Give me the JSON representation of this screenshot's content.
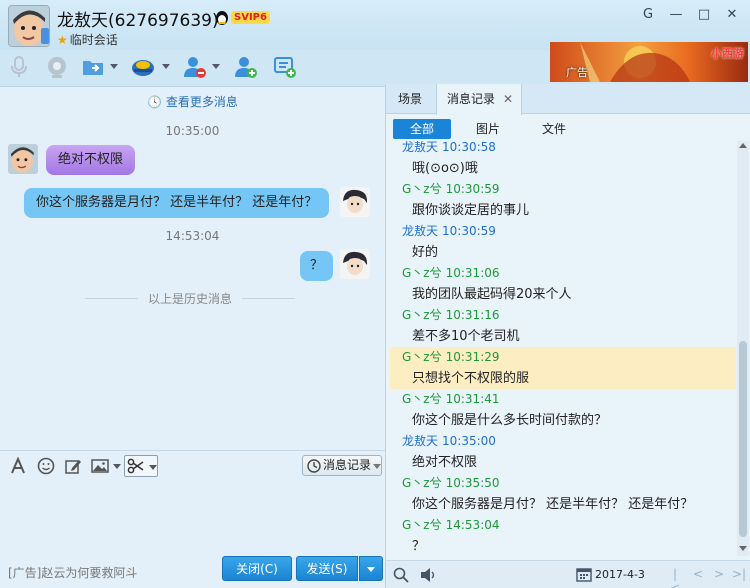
{
  "header": {
    "contact_name": "龙敖天(627697639)",
    "vip_badge": "SVIP6",
    "session_type": "临时会话",
    "window_controls": [
      "G",
      "—",
      "□",
      "✕"
    ]
  },
  "ad_banner": {
    "label": "广告",
    "game_name": "小西游"
  },
  "chat": {
    "more_messages": "查看更多消息",
    "timestamps": [
      "10:35:00",
      "14:53:04"
    ],
    "messages": [
      {
        "side": "in",
        "text": "绝对不权限"
      },
      {
        "side": "out",
        "text": "你这个服务器是月付？  还是半年付？  还是年付？"
      },
      {
        "side": "out",
        "text": "？"
      }
    ],
    "history_divider": "以上是历史消息"
  },
  "input_toolbar": {
    "message_record_button": "消息记录"
  },
  "bottom_bar": {
    "ad_text": "[广告]赵云为何要救阿斗",
    "close_button": "关闭(C)",
    "send_button": "发送(S)"
  },
  "history_panel": {
    "tabs": [
      "场景",
      "消息记录"
    ],
    "subtabs": [
      "全部",
      "图片",
      "文件"
    ],
    "entries": [
      {
        "sender": "龙敖天",
        "time": "10:30:58",
        "sender_color": "blue",
        "text": "哦(⊙o⊙)哦"
      },
      {
        "sender": "G丶z兮",
        "time": "10:30:59",
        "sender_color": "green",
        "text": "跟你谈谈定居的事儿"
      },
      {
        "sender": "龙敖天",
        "time": "10:30:59",
        "sender_color": "blue",
        "text": "好的"
      },
      {
        "sender": "G丶z兮",
        "time": "10:31:06",
        "sender_color": "green",
        "text": "我的团队最起码得20来个人"
      },
      {
        "sender": "G丶z兮",
        "time": "10:31:16",
        "sender_color": "green",
        "text": "差不多10个老司机"
      },
      {
        "sender": "G丶z兮",
        "time": "10:31:29",
        "sender_color": "green",
        "text": "只想找个不权限的服"
      },
      {
        "sender": "G丶z兮",
        "time": "10:31:41",
        "sender_color": "green",
        "text": "你这个服是什么多长时间付款的？"
      },
      {
        "sender": "龙敖天",
        "time": "10:35:00",
        "sender_color": "blue",
        "text": "绝对不权限"
      },
      {
        "sender": "G丶z兮",
        "time": "10:35:50",
        "sender_color": "green",
        "text": "你这个服务器是月付？  还是半年付？  还是年付？"
      },
      {
        "sender": "G丶z兮",
        "time": "14:53:04",
        "sender_color": "green",
        "text": "？"
      }
    ],
    "date": "2017-4-3"
  },
  "colors": {
    "accent_blue": "#1a84d8",
    "sender_blue": "#1f6fd0",
    "sender_green": "#1c9a38",
    "highlight": "#fdedc2"
  }
}
